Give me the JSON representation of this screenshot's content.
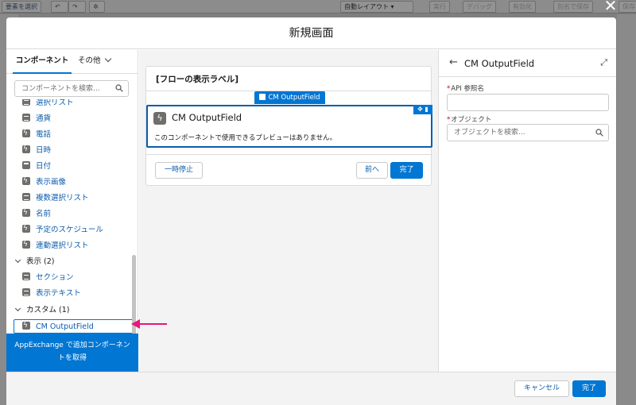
{
  "background": {
    "toolbar": {
      "select_element": "要素を選択",
      "auto_layout": "自動レイアウト",
      "run": "実行",
      "debug": "デバッグ",
      "activate": "有効化",
      "save_as": "別名で保存",
      "save": "保存"
    }
  },
  "modal": {
    "title": "新規画面",
    "close_icon": "close-icon"
  },
  "palette": {
    "tab_components": "コンポーネント",
    "tab_other": "その他",
    "search_placeholder": "コンポーネントを検索...",
    "items": [
      {
        "label": "選択リスト",
        "icon": "picklist-icon"
      },
      {
        "label": "通貨",
        "icon": "currency-icon"
      },
      {
        "label": "電話",
        "icon": "phone-icon"
      },
      {
        "label": "日時",
        "icon": "datetime-icon"
      },
      {
        "label": "日付",
        "icon": "date-icon"
      },
      {
        "label": "表示画像",
        "icon": "image-icon"
      },
      {
        "label": "複数選択リスト",
        "icon": "multiselect-icon"
      },
      {
        "label": "名前",
        "icon": "name-icon"
      },
      {
        "label": "予定のスケジュール",
        "icon": "schedule-icon"
      },
      {
        "label": "連動選択リスト",
        "icon": "dependent-picklist-icon"
      }
    ],
    "section_display": "表示 (2)",
    "display_items": [
      {
        "label": "セクション",
        "icon": "section-icon"
      },
      {
        "label": "表示テキスト",
        "icon": "display-text-icon"
      }
    ],
    "section_custom": "カスタム (1)",
    "custom_items": [
      {
        "label": "CM OutputField",
        "icon": "lightning-icon"
      }
    ],
    "appexchange_line1": "AppExchange で追加コンポーネン",
    "appexchange_line2": "トを取得"
  },
  "canvas": {
    "screen_label": "[フローの表示ラベル]",
    "component_tag": "CM OutputField",
    "component_title": "CM OutputField",
    "component_desc": "このコンポーネントで使用できるプレビューはありません。",
    "pause_button": "一時停止",
    "previous_button": "前へ",
    "finish_button": "完了"
  },
  "properties": {
    "title": "CM OutputField",
    "api_name_label": "API 参照名",
    "api_name_value": "",
    "object_label": "オブジェクト",
    "object_placeholder": "オブジェクトを検索..."
  },
  "footer": {
    "cancel_button": "キャンセル",
    "done_button": "完了"
  },
  "colors": {
    "brand": "#0176d3",
    "annotation_arrow": "#e8177a"
  }
}
